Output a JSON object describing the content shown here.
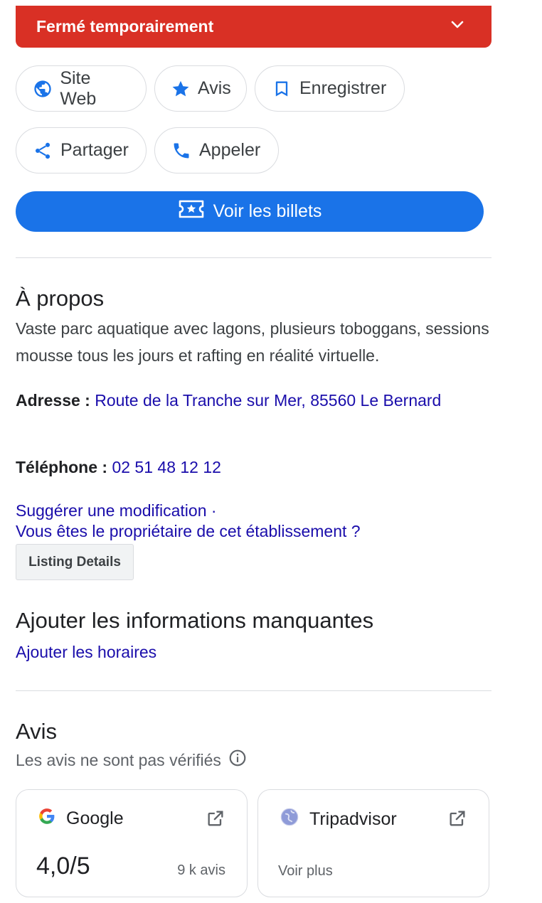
{
  "status": {
    "label": "Fermé temporairement"
  },
  "actions": {
    "website": "Site Web",
    "reviews": "Avis",
    "save": "Enregistrer",
    "share": "Partager",
    "call": "Appeler",
    "tickets": "Voir les billets"
  },
  "about": {
    "title": "À propos",
    "description": "Vaste parc aquatique avec lagons, plusieurs toboggans, sessions mousse tous les jours et rafting en réalité virtuelle.",
    "address_label": "Adresse :",
    "address_value": "Route de la Tranche sur Mer, 85560 Le Bernard",
    "phone_label": "Téléphone :",
    "phone_value": "02 51 48 12 12",
    "suggest_edit": "Suggérer une modification ·",
    "owner_question": "Vous êtes le propriétaire de cet établissement ?",
    "listing_details": "Listing Details"
  },
  "missing": {
    "title": "Ajouter les informations manquantes",
    "add_hours": "Ajouter les horaires"
  },
  "reviews": {
    "title": "Avis",
    "subtitle": "Les avis ne sont pas vérifiés",
    "cards": [
      {
        "source": "Google",
        "rating": "4,0/5",
        "count": "9 k avis"
      },
      {
        "source": "Tripadvisor",
        "more": "Voir plus"
      }
    ]
  },
  "colors": {
    "closed_banner": "#d93025",
    "primary": "#1a73e8",
    "link": "#1a0dab"
  }
}
